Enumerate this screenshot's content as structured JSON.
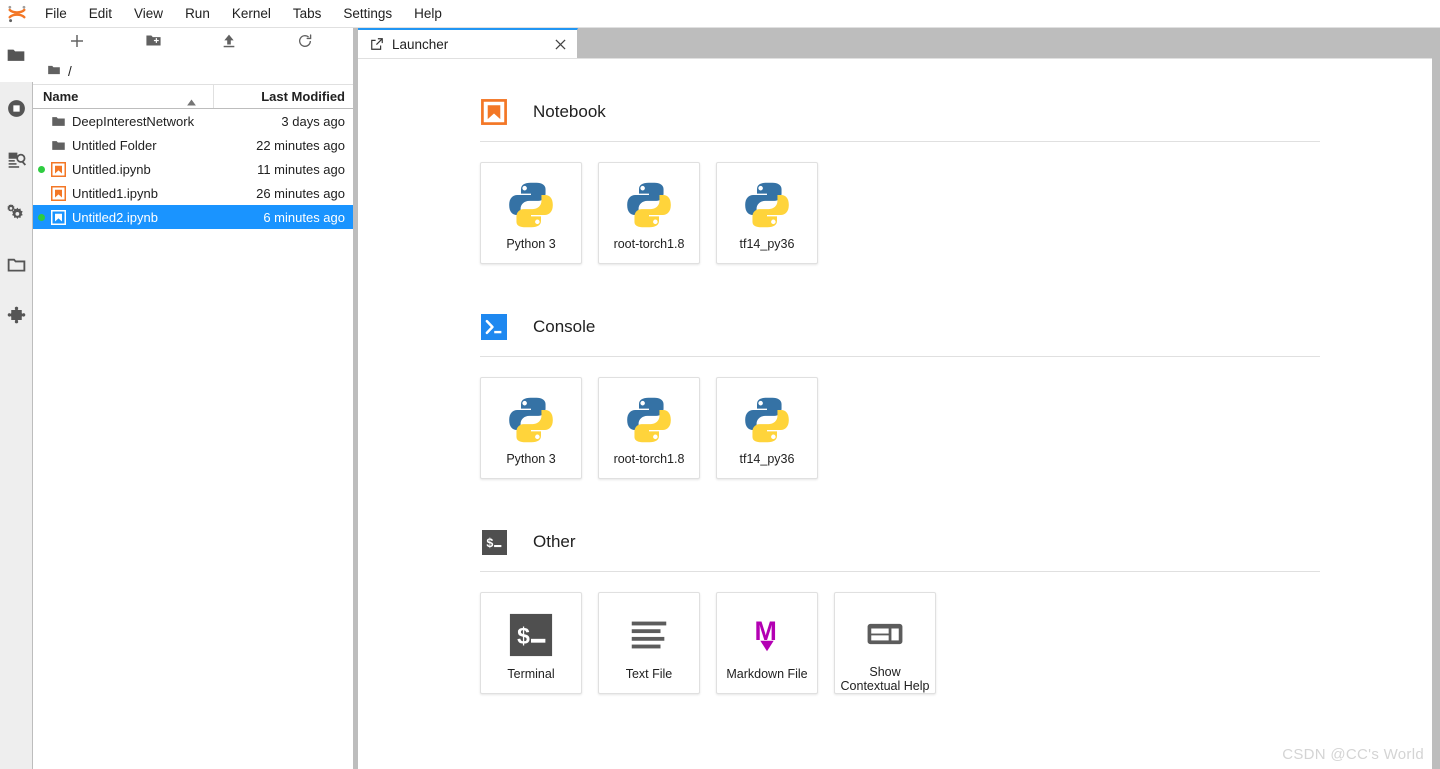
{
  "menubar": {
    "logo_icon": "jupyter-logo",
    "items": [
      {
        "label": "File"
      },
      {
        "label": "Edit"
      },
      {
        "label": "View"
      },
      {
        "label": "Run"
      },
      {
        "label": "Kernel"
      },
      {
        "label": "Tabs"
      },
      {
        "label": "Settings"
      },
      {
        "label": "Help"
      }
    ]
  },
  "activitybar": {
    "items": [
      {
        "name": "file-browser",
        "icon": "folder-icon",
        "active": true
      },
      {
        "name": "running-terminals-and-kernels",
        "icon": "stop-circle-icon",
        "active": false
      },
      {
        "name": "command-palette",
        "icon": "document-search-icon",
        "active": false
      },
      {
        "name": "kernels-and-settings",
        "icon": "gears-icon",
        "active": false
      },
      {
        "name": "open-tabs",
        "icon": "window-icon",
        "active": false
      },
      {
        "name": "extension-manager",
        "icon": "puzzle-icon",
        "active": false
      }
    ]
  },
  "filebrowser": {
    "toolbar": [
      {
        "name": "new-launcher",
        "icon": "plus-icon",
        "title": "New Launcher"
      },
      {
        "name": "new-folder",
        "icon": "new-folder-icon",
        "title": "New Folder"
      },
      {
        "name": "upload",
        "icon": "upload-icon",
        "title": "Upload Files"
      },
      {
        "name": "refresh",
        "icon": "refresh-icon",
        "title": "Refresh File List"
      }
    ],
    "breadcrumb": "/",
    "columns": {
      "name": "Name",
      "last_modified": "Last Modified"
    },
    "sort": {
      "column": "Name",
      "direction": "asc"
    },
    "rows": [
      {
        "name": "DeepInterestNetwork",
        "modified": "3 days ago",
        "type": "folder",
        "running": false,
        "selected": false
      },
      {
        "name": "Untitled Folder",
        "modified": "22 minutes ago",
        "type": "folder",
        "running": false,
        "selected": false
      },
      {
        "name": "Untitled.ipynb",
        "modified": "11 minutes ago",
        "type": "notebook",
        "running": true,
        "selected": false
      },
      {
        "name": "Untitled1.ipynb",
        "modified": "26 minutes ago",
        "type": "notebook",
        "running": false,
        "selected": false
      },
      {
        "name": "Untitled2.ipynb",
        "modified": "6 minutes ago",
        "type": "notebook",
        "running": true,
        "selected": true
      }
    ]
  },
  "tabbar": {
    "tabs": [
      {
        "label": "Launcher",
        "icon": "launcher-icon",
        "close_icon": "close-icon",
        "active": true
      }
    ]
  },
  "launcher": {
    "sections": [
      {
        "title": "Notebook",
        "icon": "notebook-icon",
        "cards": [
          {
            "label": "Python 3",
            "icon": "python-logo"
          },
          {
            "label": "root-torch1.8",
            "icon": "python-logo"
          },
          {
            "label": "tf14_py36",
            "icon": "python-logo"
          }
        ]
      },
      {
        "title": "Console",
        "icon": "console-icon",
        "cards": [
          {
            "label": "Python 3",
            "icon": "python-logo"
          },
          {
            "label": "root-torch1.8",
            "icon": "python-logo"
          },
          {
            "label": "tf14_py36",
            "icon": "python-logo"
          }
        ]
      },
      {
        "title": "Other",
        "icon": "terminal-icon",
        "cards": [
          {
            "label": "Terminal",
            "icon": "terminal-icon"
          },
          {
            "label": "Text File",
            "icon": "text-file-icon"
          },
          {
            "label": "Markdown File",
            "icon": "markdown-icon"
          },
          {
            "label": "Show\nContextual Help",
            "icon": "contextual-help-icon"
          }
        ]
      }
    ]
  },
  "watermark": "CSDN @CC's World",
  "colors": {
    "accent_blue": "#1a94ff",
    "tab_active_border": "#2196f3",
    "notebook_orange": "#f37726",
    "console_blue": "#1e88f0",
    "terminal_dark": "#4f4f4f",
    "markdown_purple": "#b300b3",
    "running_green": "#2ecc40",
    "panel_grey": "#bdbdbd",
    "sidebar_grey": "#eeeeee"
  }
}
